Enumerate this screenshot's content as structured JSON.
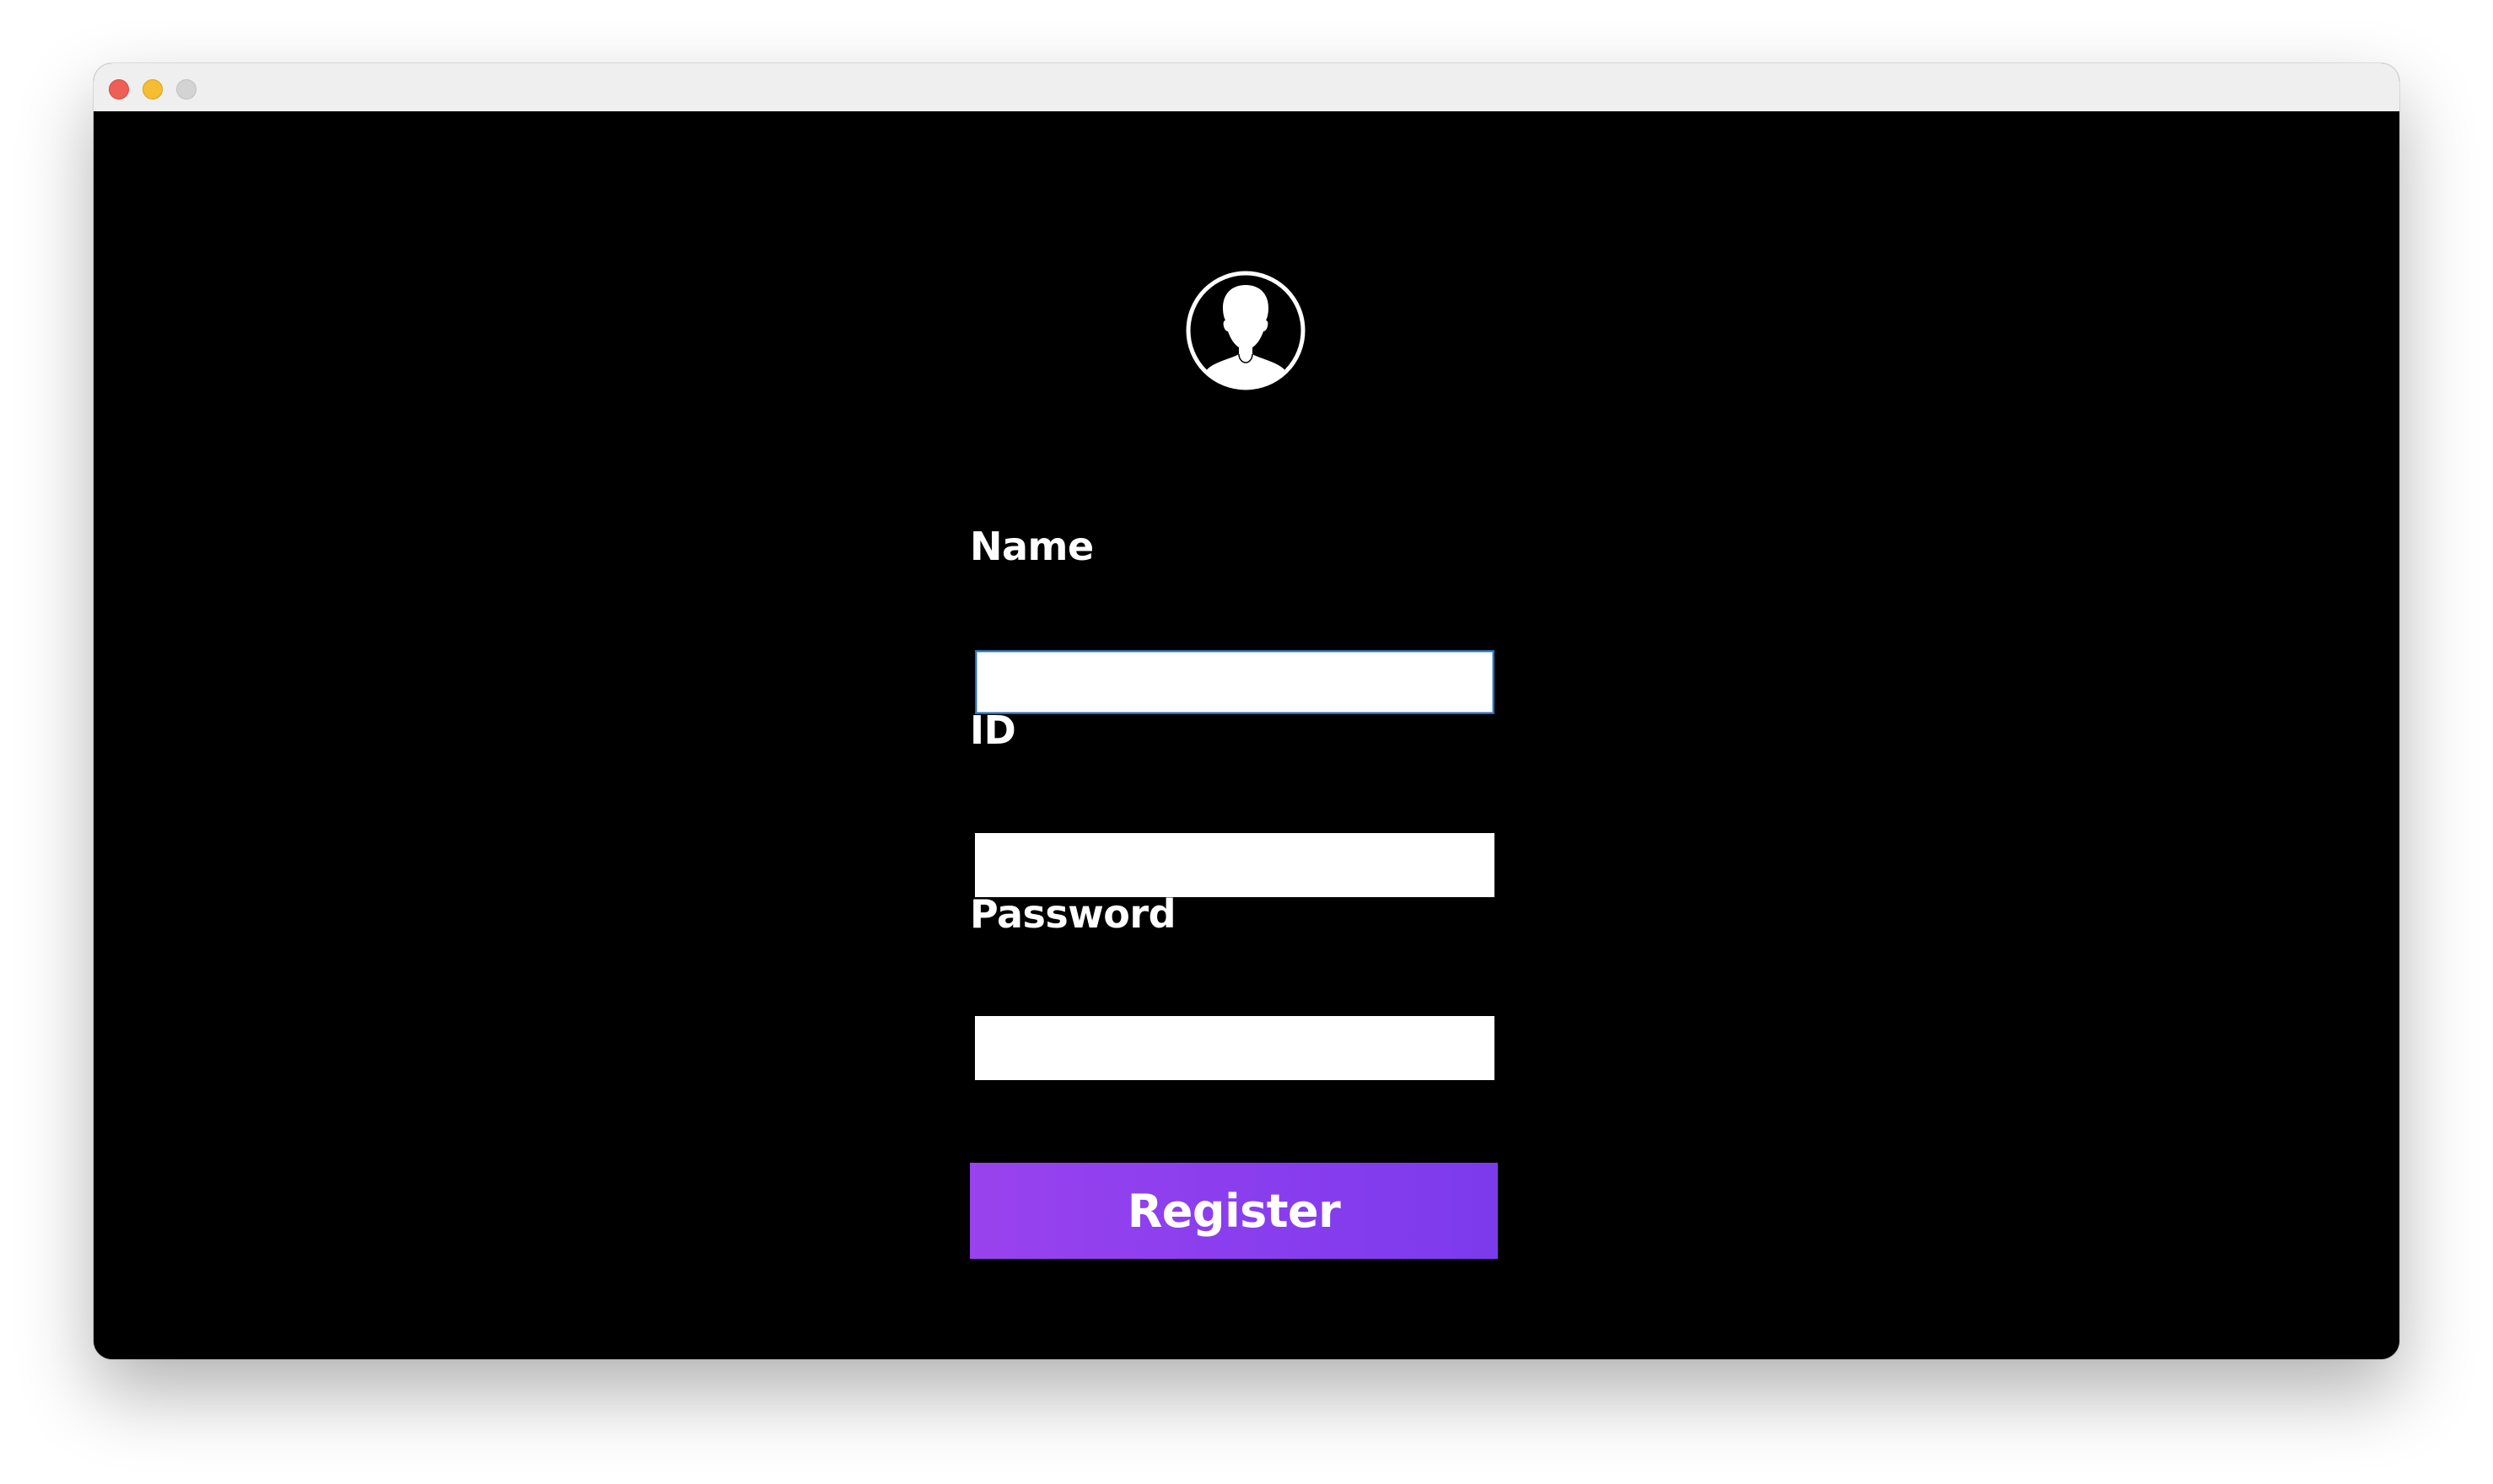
{
  "window": {
    "controls": {
      "close_icon": "close-icon",
      "minimize_icon": "minimize-icon",
      "maximize_icon": "maximize-icon"
    }
  },
  "form": {
    "avatar_icon": "user-avatar-icon",
    "name_label": "Name",
    "name_value": "",
    "id_label": "ID",
    "id_value": "",
    "password_label": "Password",
    "password_value": "",
    "register_label": "Register"
  },
  "colors": {
    "background": "#000000",
    "button_gradient_start": "#9942ee",
    "button_gradient_end": "#7c3aed",
    "text": "#ffffff",
    "focus_border": "#2f6fb0"
  }
}
